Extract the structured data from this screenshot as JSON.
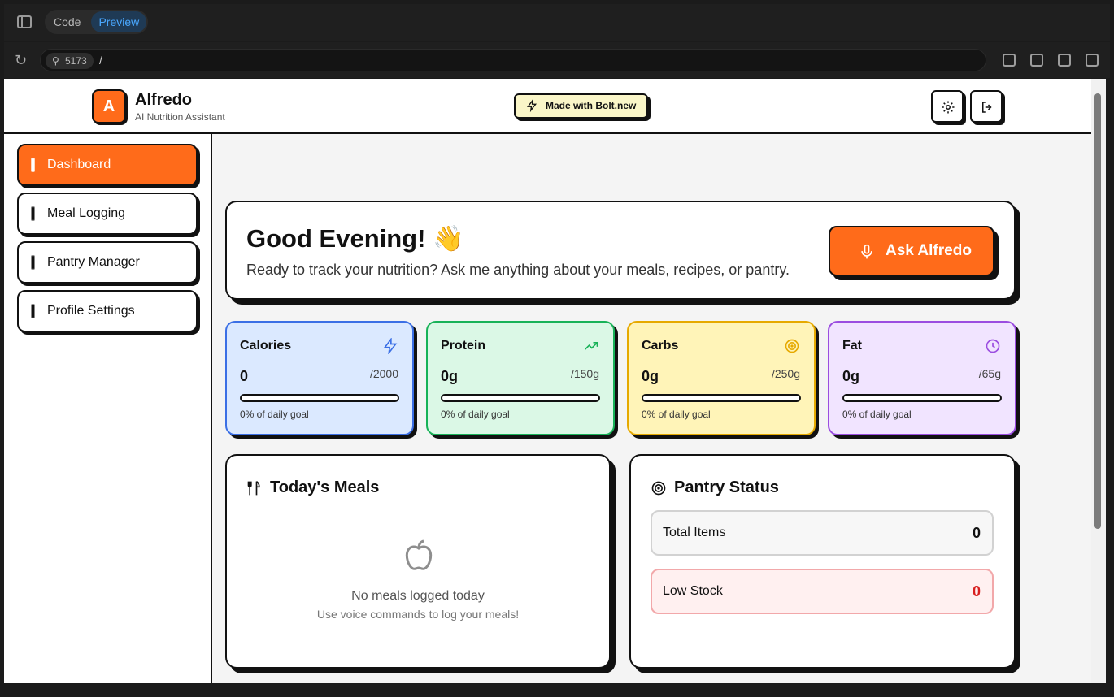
{
  "browser": {
    "tabs": [
      "Code",
      "Preview"
    ],
    "active_tab": "Preview",
    "port": "5173",
    "path": "/"
  },
  "app": {
    "logo_letter": "A",
    "name": "Alfredo",
    "subtitle": "AI Nutrition Assistant",
    "badge": "Made with Bolt.new"
  },
  "sidebar": {
    "items": [
      {
        "label": "Dashboard",
        "active": true
      },
      {
        "label": "Meal Logging"
      },
      {
        "label": "Pantry Manager"
      },
      {
        "label": "Profile Settings"
      }
    ]
  },
  "greeting": {
    "title": "Good Evening! 👋",
    "text": "Ready to track your nutrition? Ask me anything about your meals, recipes, or pantry.",
    "button": "Ask Alfredo"
  },
  "stats": [
    {
      "name": "Calories",
      "value": "0",
      "goal": "/2000",
      "progress": 0,
      "percent_text": "0% of daily goal",
      "icon": "bolt-icon",
      "color": "#3b6fe5"
    },
    {
      "name": "Protein",
      "value": "0g",
      "goal": "/150g",
      "progress": 0,
      "percent_text": "0% of daily goal",
      "icon": "trend-up-icon",
      "color": "#18b258"
    },
    {
      "name": "Carbs",
      "value": "0g",
      "goal": "/250g",
      "progress": 0,
      "percent_text": "0% of daily goal",
      "icon": "target-icon",
      "color": "#e6a900"
    },
    {
      "name": "Fat",
      "value": "0g",
      "goal": "/65g",
      "progress": 0,
      "percent_text": "0% of daily goal",
      "icon": "clock-icon",
      "color": "#9b4de0"
    }
  ],
  "meals": {
    "title": "Today's Meals",
    "empty_title": "No meals logged today",
    "empty_text": "Use voice commands to log your meals!"
  },
  "pantry": {
    "title": "Pantry Status",
    "total_label": "Total Items",
    "total_value": "0",
    "low_label": "Low Stock",
    "low_value": "0"
  }
}
